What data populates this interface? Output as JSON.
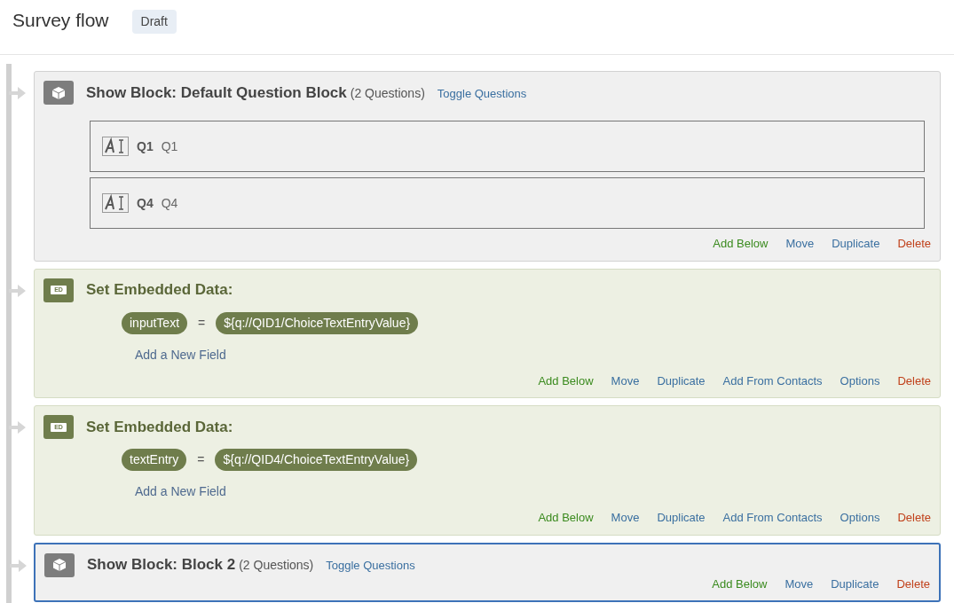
{
  "header": {
    "title": "Survey flow",
    "status": "Draft"
  },
  "flow": [
    {
      "kind": "block",
      "selected": false,
      "title": "Show Block: Default Question Block",
      "count": "(2 Questions)",
      "toggle": "Toggle Questions",
      "questions": [
        {
          "id": "Q1",
          "text": "Q1"
        },
        {
          "id": "Q4",
          "text": "Q4"
        }
      ],
      "actions": [
        {
          "label": "Add Below",
          "kind": "add"
        },
        {
          "label": "Move",
          "kind": "neutral"
        },
        {
          "label": "Duplicate",
          "kind": "neutral"
        },
        {
          "label": "Delete",
          "kind": "delete"
        }
      ]
    },
    {
      "kind": "embedded",
      "selected": false,
      "icon_text": "ED",
      "title": "Set Embedded Data:",
      "fields": [
        {
          "name": "inputText",
          "op": "=",
          "value": "${q://QID1/ChoiceTextEntryValue}"
        }
      ],
      "add_field": "Add a New Field",
      "actions": [
        {
          "label": "Add Below",
          "kind": "add"
        },
        {
          "label": "Move",
          "kind": "neutral"
        },
        {
          "label": "Duplicate",
          "kind": "neutral"
        },
        {
          "label": "Add From Contacts",
          "kind": "neutral"
        },
        {
          "label": "Options",
          "kind": "neutral"
        },
        {
          "label": "Delete",
          "kind": "delete"
        }
      ]
    },
    {
      "kind": "embedded",
      "selected": false,
      "icon_text": "ED",
      "title": "Set Embedded Data:",
      "fields": [
        {
          "name": "textEntry",
          "op": "=",
          "value": "${q://QID4/ChoiceTextEntryValue}"
        }
      ],
      "add_field": "Add a New Field",
      "actions": [
        {
          "label": "Add Below",
          "kind": "add"
        },
        {
          "label": "Move",
          "kind": "neutral"
        },
        {
          "label": "Duplicate",
          "kind": "neutral"
        },
        {
          "label": "Add From Contacts",
          "kind": "neutral"
        },
        {
          "label": "Options",
          "kind": "neutral"
        },
        {
          "label": "Delete",
          "kind": "delete"
        }
      ]
    },
    {
      "kind": "block",
      "selected": true,
      "title": "Show Block: Block 2",
      "count": "(2 Questions)",
      "toggle": "Toggle Questions",
      "actions": [
        {
          "label": "Add Below",
          "kind": "add"
        },
        {
          "label": "Move",
          "kind": "neutral"
        },
        {
          "label": "Duplicate",
          "kind": "neutral"
        },
        {
          "label": "Delete",
          "kind": "delete"
        }
      ]
    }
  ]
}
